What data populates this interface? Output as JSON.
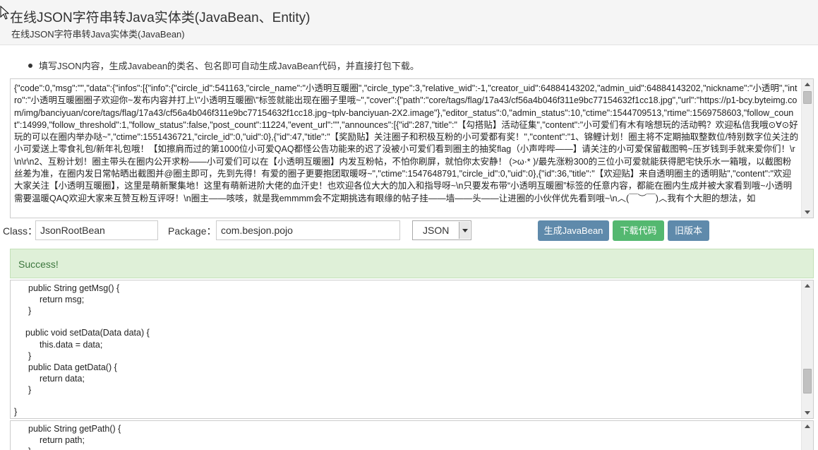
{
  "header": {
    "title": "在线JSON字符串转Java实体类(JavaBean、Entity)",
    "subtitle": "在线JSON字符串转Java实体类(JavaBean)"
  },
  "intro": {
    "text": "填写JSON内容，生成Javabean的类名、包名即可自动生成JavaBean代码，并直接打包下载。"
  },
  "json_input": {
    "value": "{\"code\":0,\"msg\":\"\",\"data\":{\"infos\":[{\"info\":{\"circle_id\":541163,\"circle_name\":\"小透明互暖圈\",\"circle_type\":3,\"relative_wid\":-1,\"creator_uid\":64884143202,\"admin_uid\":64884143202,\"nickname\":\"小透明\",\"intro\":\"小透明互暖圈圈子欢迎你~发布内容并打上\\\"小透明互暖圈\\\"标签就能出现在圈子里哦~\",\"cover\":{\"path\":\"core/tags/flag/17a43/cf56a4b046f311e9bc77154632f1cc18.jpg\",\"url\":\"https://p1-bcy.byteimg.com/img/banciyuan/core/tags/flag/17a43/cf56a4b046f311e9bc77154632f1cc18.jpg~tplv-banciyuan-2X2.image\"},\"editor_status\":0,\"admin_status\":10,\"ctime\":1544709513,\"rtime\":1569758603,\"follow_count\":14999,\"follow_threshold\":1,\"follow_status\":false,\"post_count\":11224,\"event_url\":\"\",\"announces\":[{\"id\":287,\"title\":\"【勾搭贴】活动征集\",\"content\":\"小可爱们有木有啥想玩的活动鸭？欢迎私信我哦⊙∀⊙好玩的可以在圈内举办哒~\",\"ctime\":1551436721,\"circle_id\":0,\"uid\":0},{\"id\":47,\"title\":\"【奖励贴】关注圈子和积极互粉的小可爱都有奖！\",\"content\":\"1、锦鲤计划！圈主将不定期抽取整数位/特别数字位关注的小可爱送上零食礼包/新年礼包哦！【如擦肩而过的第1000位小可爱QAQ都怪公告功能来的迟了没被小可爱们看到圈主的抽奖flag（小声哔哔——】请关注的小可爱保留截图鸭~压岁钱到手就来爱你们！\\r\\n\\r\\n2、互粉计划！圈主带头在圈内公开求粉——小可爱们可以在【小透明互暖圈】内发互粉帖，不怕你刷屏，就怕你太安静！ (>ω·* )/最先涨粉300的三位小可爱就能获得肥宅快乐水一箱哦，以截图粉丝差为准，在圈内发日常帖晒出截图并@圈主即可，先到先得！有爱的圈子更要抱团取暖呀~\",\"ctime\":1547648791,\"circle_id\":0,\"uid\":0},{\"id\":36,\"title\":\"【欢迎贴】来自透明圈主的透明贴\",\"content\":\"欢迎大家关注【小透明互暖圈】，这里是萌新聚集地！这里有萌新进阶大佬的血汗史！也欢迎各位大大的加入和指导呀~\\n只要发布带“小透明互暖圈”标签的任意内容，都能在圈内生成并被大家看到哦~小透明需要温暖QAQ欢迎大家来互赞互粉互评呀！\\n圈主——咳咳，就是我emmmm会不定期挑选有眼缘的帖子挂——墙——头——让进圈的小伙伴优先看到哦~\\n︿(￣︶￣)︿我有个大胆的想法，如"
  },
  "form": {
    "class_label": "Class：",
    "class_value": "JsonRootBean",
    "package_label": "Package：",
    "package_value": "com.besjon.pojo",
    "format_value": "JSON",
    "generate_label": "生成JavaBean",
    "download_label": "下载代码",
    "old_version_label": "旧版本"
  },
  "status": {
    "text": "Success!"
  },
  "code1": {
    "lines": [
      "public String getMsg() {",
      "return msg;",
      "}",
      "public void setData(Data data) {",
      "this.data = data;",
      "}",
      "public Data getData() {",
      "return data;",
      "}",
      "}"
    ]
  },
  "code2": {
    "lines": [
      "public String getPath() {",
      "return path;",
      "}"
    ]
  },
  "colors": {
    "header_bg": "#f5f5f5",
    "success_bg": "#dff0d8",
    "success_text": "#3c763d",
    "btn_blue": "#5f8aab",
    "btn_green": "#54b870"
  },
  "icons": [
    "cursor-arrow-icon",
    "chevron-down-icon",
    "scroll-up-icon",
    "scroll-down-icon"
  ]
}
